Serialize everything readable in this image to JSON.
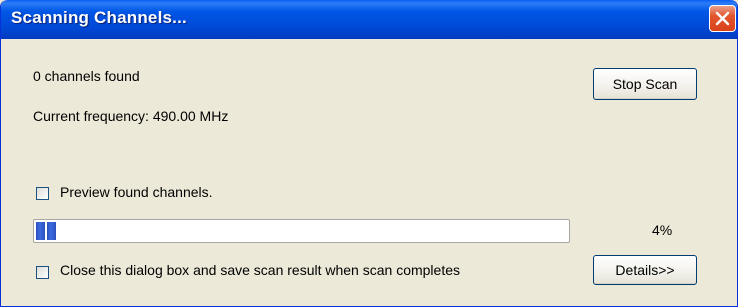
{
  "window": {
    "title": "Scanning Channels...",
    "close_icon": "close-icon"
  },
  "status": {
    "channels_found": "0 channels found",
    "current_frequency": "Current frequency: 490.00 MHz"
  },
  "buttons": {
    "stop_scan": "Stop Scan",
    "details": "Details>>"
  },
  "options": {
    "preview_label": "Preview found channels.",
    "preview_checked": false,
    "close_label": "Close this dialog box and save scan result when scan completes",
    "close_checked": false
  },
  "progress": {
    "percent_label": "4%",
    "value_percent": 4
  },
  "colors": {
    "titlebar": "#0054e3",
    "progress_fill": "#2f5fd6",
    "dialog_bg": "#ece9d8",
    "close_button": "#e2552e"
  }
}
